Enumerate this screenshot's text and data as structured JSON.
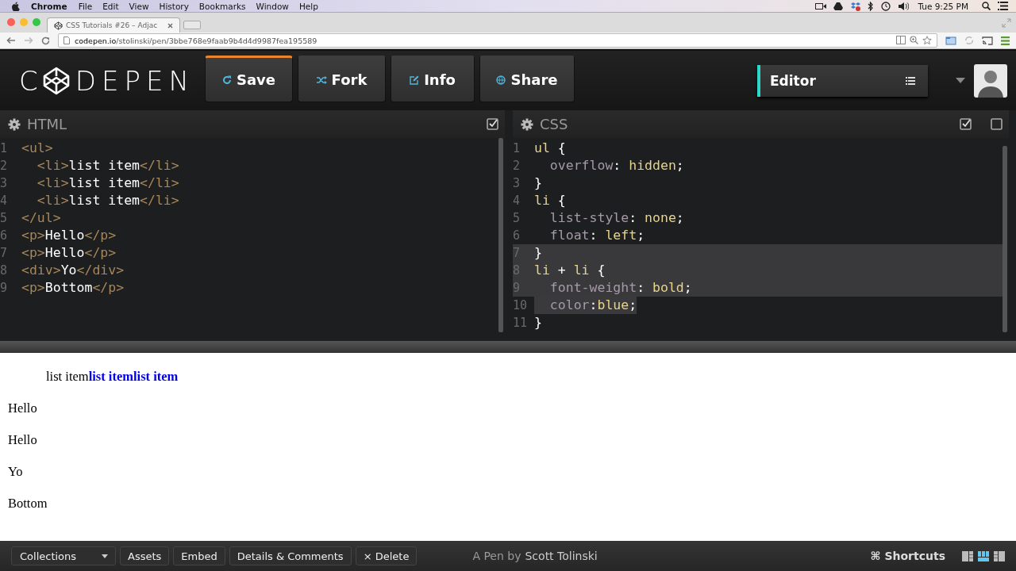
{
  "menu_bar": {
    "app": "Chrome",
    "items": [
      "File",
      "Edit",
      "View",
      "History",
      "Bookmarks",
      "Window",
      "Help"
    ],
    "clock": "Tue 9:25 PM"
  },
  "browser": {
    "tab_title": "CSS Tutorials #26 – Adjac",
    "url_host": "codepen.io",
    "url_path": "/stolinski/pen/3bbe768e9faab9b4d4d9987fea195589"
  },
  "header": {
    "logo_start": "C",
    "logo_end": "DEPEN",
    "buttons": [
      {
        "kind": "save",
        "label": "Save",
        "selected": true
      },
      {
        "kind": "fork",
        "label": "Fork",
        "selected": false
      },
      {
        "kind": "info",
        "label": "Info",
        "selected": false
      },
      {
        "kind": "share",
        "label": "Share",
        "selected": false
      }
    ],
    "view_menu": {
      "label": "Editor"
    }
  },
  "editors": [
    {
      "title": "HTML",
      "toggles": [
        {
          "checked": true
        }
      ],
      "lines": [
        {
          "number": "1",
          "tokens": [
            {
              "kind": "tag",
              "text": "<ul>"
            }
          ]
        },
        {
          "number": "2",
          "tokens": [
            {
              "kind": "tag",
              "text": "  <li>"
            },
            {
              "kind": "text",
              "text": "list item"
            },
            {
              "kind": "tag",
              "text": "</li>"
            }
          ]
        },
        {
          "number": "3",
          "tokens": [
            {
              "kind": "tag",
              "text": "  <li>"
            },
            {
              "kind": "text",
              "text": "list item"
            },
            {
              "kind": "tag",
              "text": "</li>"
            }
          ]
        },
        {
          "number": "4",
          "tokens": [
            {
              "kind": "tag",
              "text": "  <li>"
            },
            {
              "kind": "text",
              "text": "list item"
            },
            {
              "kind": "tag",
              "text": "</li>"
            }
          ]
        },
        {
          "number": "5",
          "tokens": [
            {
              "kind": "tag",
              "text": "</ul>"
            }
          ]
        },
        {
          "number": "6",
          "tokens": [
            {
              "kind": "tag",
              "text": "<p>"
            },
            {
              "kind": "text",
              "text": "Hello"
            },
            {
              "kind": "tag",
              "text": "</p>"
            }
          ]
        },
        {
          "number": "7",
          "tokens": [
            {
              "kind": "tag",
              "text": "<p>"
            },
            {
              "kind": "text",
              "text": "Hello"
            },
            {
              "kind": "tag",
              "text": "</p>"
            }
          ]
        },
        {
          "number": "8",
          "tokens": [
            {
              "kind": "tag",
              "text": "<div>"
            },
            {
              "kind": "text",
              "text": "Yo"
            },
            {
              "kind": "tag",
              "text": "</div>"
            }
          ]
        },
        {
          "number": "9",
          "tokens": [
            {
              "kind": "tag",
              "text": "<p>"
            },
            {
              "kind": "text",
              "text": "Bottom"
            },
            {
              "kind": "tag",
              "text": "</p>"
            }
          ]
        }
      ]
    },
    {
      "title": "CSS",
      "toggles": [
        {
          "checked": true
        },
        {
          "checked": false
        }
      ],
      "lines": [
        {
          "number": "1",
          "highlighted": false,
          "text_selected": false,
          "tokens": [
            {
              "kind": "selector",
              "text": "ul"
            },
            {
              "kind": "punct",
              "text": " {"
            }
          ]
        },
        {
          "number": "2",
          "highlighted": false,
          "text_selected": false,
          "tokens": [
            {
              "kind": "prop",
              "text": "  overflow"
            },
            {
              "kind": "punct",
              "text": ": "
            },
            {
              "kind": "value",
              "text": "hidden"
            },
            {
              "kind": "punct",
              "text": ";"
            }
          ]
        },
        {
          "number": "3",
          "highlighted": false,
          "text_selected": false,
          "tokens": [
            {
              "kind": "punct",
              "text": "}"
            }
          ]
        },
        {
          "number": "4",
          "highlighted": false,
          "text_selected": false,
          "tokens": [
            {
              "kind": "selector",
              "text": "li"
            },
            {
              "kind": "punct",
              "text": " {"
            }
          ]
        },
        {
          "number": "5",
          "highlighted": false,
          "text_selected": false,
          "tokens": [
            {
              "kind": "prop",
              "text": "  list-style"
            },
            {
              "kind": "punct",
              "text": ": "
            },
            {
              "kind": "value",
              "text": "none"
            },
            {
              "kind": "punct",
              "text": ";"
            }
          ]
        },
        {
          "number": "6",
          "highlighted": false,
          "text_selected": false,
          "tokens": [
            {
              "kind": "prop",
              "text": "  float"
            },
            {
              "kind": "punct",
              "text": ": "
            },
            {
              "kind": "value",
              "text": "left"
            },
            {
              "kind": "punct",
              "text": ";"
            }
          ]
        },
        {
          "number": "7",
          "highlighted": true,
          "text_selected": false,
          "tokens": [
            {
              "kind": "punct",
              "text": "}"
            }
          ]
        },
        {
          "number": "8",
          "highlighted": true,
          "text_selected": false,
          "tokens": [
            {
              "kind": "selector",
              "text": "li"
            },
            {
              "kind": "punct",
              "text": " + "
            },
            {
              "kind": "selector",
              "text": "li"
            },
            {
              "kind": "punct",
              "text": " {"
            }
          ]
        },
        {
          "number": "9",
          "highlighted": true,
          "text_selected": false,
          "tokens": [
            {
              "kind": "prop",
              "text": "  font-weight"
            },
            {
              "kind": "punct",
              "text": ": "
            },
            {
              "kind": "value",
              "text": "bold"
            },
            {
              "kind": "punct",
              "text": ";"
            }
          ]
        },
        {
          "number": "10",
          "highlighted": false,
          "text_selected": true,
          "tokens": [
            {
              "kind": "prop",
              "text": "  color"
            },
            {
              "kind": "punct",
              "text": ":"
            },
            {
              "kind": "value",
              "text": "blue"
            },
            {
              "kind": "punct",
              "text": ";"
            }
          ]
        },
        {
          "number": "11",
          "highlighted": false,
          "text_selected": false,
          "tokens": [
            {
              "kind": "punct",
              "text": "}"
            }
          ]
        }
      ]
    }
  ],
  "preview": {
    "list_items": [
      {
        "text": "list item",
        "styled": false
      },
      {
        "text": "list item",
        "styled": true
      },
      {
        "text": "list item",
        "styled": true
      }
    ],
    "paragraphs": [
      "Hello",
      "Hello",
      "Yo",
      "Bottom"
    ]
  },
  "footer": {
    "buttons": [
      {
        "kind": "dropdown",
        "label": "Collections"
      },
      {
        "kind": "plain",
        "label": "Assets"
      },
      {
        "kind": "plain",
        "label": "Embed"
      },
      {
        "kind": "plain",
        "label": "Details & Comments"
      },
      {
        "kind": "delete",
        "label": "× Delete"
      }
    ],
    "credit_prefix": "A Pen by",
    "author": "Scott Tolinski",
    "shortcuts": "⌘ Shortcuts",
    "layouts": [
      {
        "selected": false
      },
      {
        "selected": true
      },
      {
        "selected": false
      }
    ]
  }
}
